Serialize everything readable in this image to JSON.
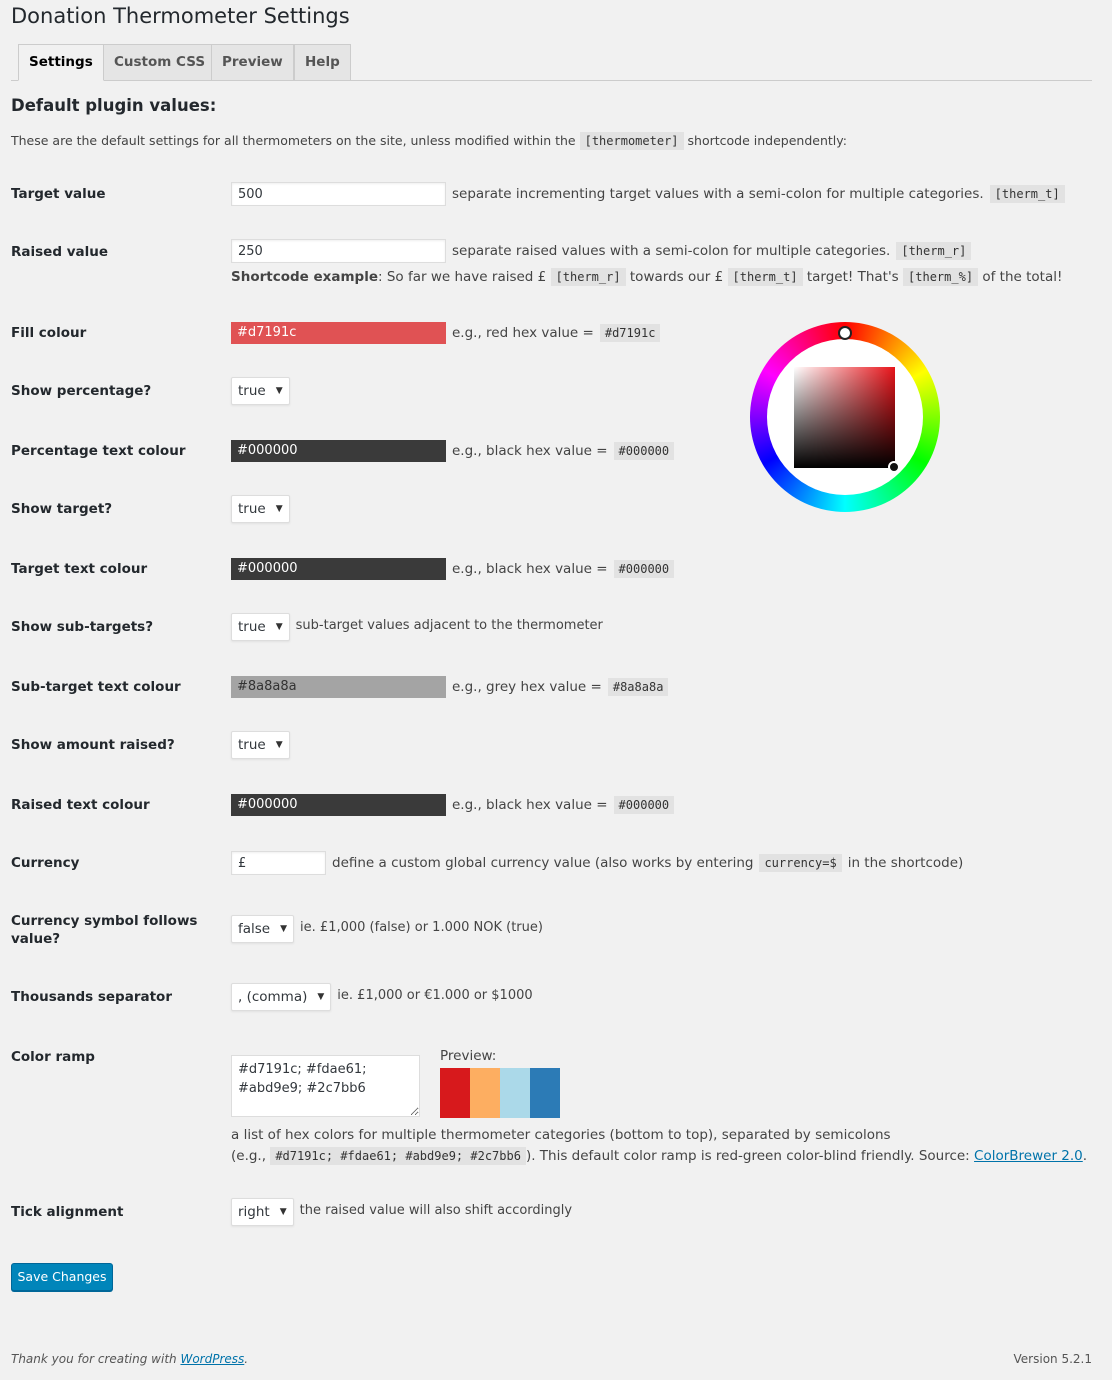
{
  "page": {
    "title": "Donation Thermometer Settings"
  },
  "tabs": [
    {
      "label": "Settings",
      "active": true
    },
    {
      "label": "Custom CSS",
      "active": false
    },
    {
      "label": "Preview",
      "active": false
    },
    {
      "label": "Help",
      "active": false
    }
  ],
  "section": {
    "heading": "Default plugin values:",
    "intro_pre": "These are the default settings for all thermometers on the site, unless modified within the",
    "intro_code": "[thermometer]",
    "intro_post": "shortcode independently:"
  },
  "target_value": {
    "label": "Target value",
    "value": "500",
    "note": "separate incrementing target values with a semi-colon for multiple categories.",
    "code": "[therm_t]"
  },
  "raised_value": {
    "label": "Raised value",
    "value": "250",
    "note": "separate raised values with a semi-colon for multiple categories.",
    "code": "[therm_r]",
    "example_bold": "Shortcode example",
    "example_1": ": So far we have raised £",
    "example_code1": "[therm_r]",
    "example_2": "towards our £",
    "example_code2": "[therm_t]",
    "example_3": "target! That's",
    "example_code3": "[therm_%]",
    "example_4": "of the total!"
  },
  "fill_colour": {
    "label": "Fill colour",
    "value": "#d7191c",
    "note": "e.g., red hex value =",
    "code": "#d7191c",
    "bg": "#e05254",
    "fg": "#ffffff"
  },
  "show_percentage": {
    "label": "Show percentage?",
    "value": "true"
  },
  "percentage_text_colour": {
    "label": "Percentage text colour",
    "value": "#000000",
    "note": "e.g., black hex value =",
    "code": "#000000",
    "bg": "#3a3a3a",
    "fg": "#ffffff"
  },
  "show_target": {
    "label": "Show target?",
    "value": "true"
  },
  "target_text_colour": {
    "label": "Target text colour",
    "value": "#000000",
    "note": "e.g., black hex value =",
    "code": "#000000",
    "bg": "#3a3a3a",
    "fg": "#ffffff"
  },
  "show_subtargets": {
    "label": "Show sub-targets?",
    "value": "true",
    "note": "sub-target values adjacent to the thermometer"
  },
  "subtarget_text_colour": {
    "label": "Sub-target text colour",
    "value": "#8a8a8a",
    "note": "e.g., grey hex value =",
    "code": "#8a8a8a",
    "bg": "#a4a4a4",
    "fg": "#333333"
  },
  "show_amount_raised": {
    "label": "Show amount raised?",
    "value": "true"
  },
  "raised_text_colour": {
    "label": "Raised text colour",
    "value": "#000000",
    "note": "e.g., black hex value =",
    "code": "#000000",
    "bg": "#3a3a3a",
    "fg": "#ffffff"
  },
  "currency": {
    "label": "Currency",
    "value": "£",
    "note_pre": "define a custom global currency value (also works by entering",
    "code": "currency=$",
    "note_post": "in the shortcode)"
  },
  "currency_follows": {
    "label": "Currency symbol follows value?",
    "value": "false",
    "note": "ie. £1,000 (false) or 1.000 NOK (true)"
  },
  "thousands_separator": {
    "label": "Thousands separator",
    "value": ", (comma)",
    "note": "ie. £1,000 or €1.000 or $1000"
  },
  "color_ramp": {
    "label": "Color ramp",
    "value": "#d7191c; #fdae61; #abd9e9; #2c7bb6",
    "preview_label": "Preview:",
    "swatches": [
      "#d7191c",
      "#fdae61",
      "#abd9e9",
      "#2c7bb6"
    ],
    "desc_line1": "a list of hex colors for multiple thermometer categories (bottom to top), separated by semicolons",
    "desc_pre": "(e.g.,",
    "desc_code": "#d7191c; #fdae61; #abd9e9; #2c7bb6",
    "desc_mid": "). This default color ramp is red-green color-blind friendly. Source:",
    "desc_link": "ColorBrewer 2.0",
    "desc_end": "."
  },
  "tick_alignment": {
    "label": "Tick alignment",
    "value": "right",
    "note": "the raised value will also shift accordingly"
  },
  "save_button": "Save Changes",
  "footer": {
    "thanks_pre": "Thank you for creating with",
    "thanks_link": "WordPress",
    "thanks_post": ".",
    "version": "Version 5.2.1"
  }
}
